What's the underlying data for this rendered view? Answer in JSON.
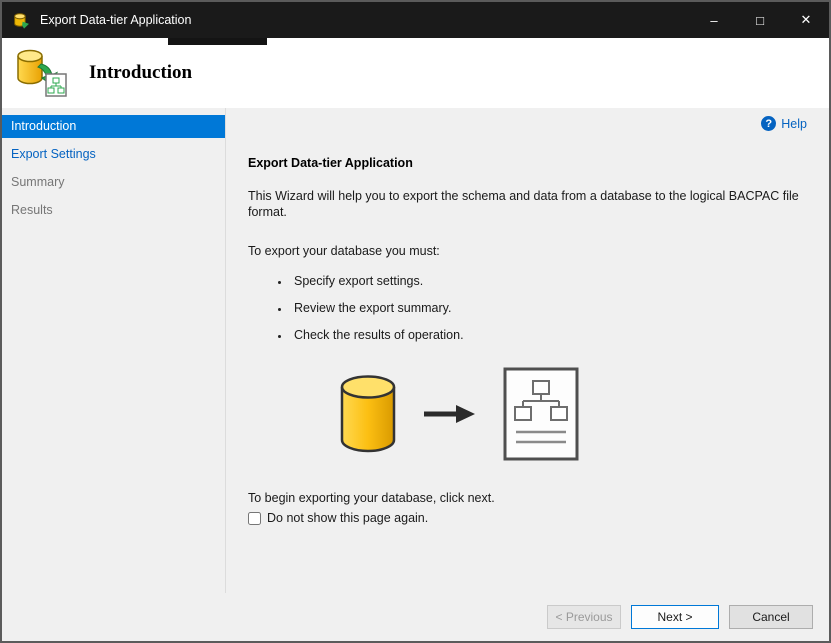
{
  "window": {
    "title": "Export Data-tier Application",
    "controls": {
      "minimize": "–",
      "maximize": "□",
      "close": "✕"
    }
  },
  "header": {
    "title": "Introduction"
  },
  "sidebar": {
    "items": [
      {
        "label": "Introduction",
        "state": "selected"
      },
      {
        "label": "Export Settings",
        "state": "link"
      },
      {
        "label": "Summary",
        "state": "disabled"
      },
      {
        "label": "Results",
        "state": "disabled"
      }
    ]
  },
  "content": {
    "help_label": "Help",
    "help_glyph": "?",
    "heading": "Export Data-tier Application",
    "intro": "This Wizard will help you to export the schema and data from a database to the logical BACPAC file format.",
    "requirements_lead": "To export your database you must:",
    "bullets": [
      "Specify export settings.",
      "Review the export summary.",
      "Check the results of operation."
    ],
    "illustration_icons": [
      "database-cylinder-icon",
      "right-arrow-icon",
      "bacpac-file-icon"
    ],
    "footer_note": "To begin exporting your database, click next.",
    "checkbox_label": "Do not show this page again.",
    "checkbox_checked": false
  },
  "buttons": {
    "previous": "< Previous",
    "next": "Next >",
    "cancel": "Cancel"
  },
  "colors": {
    "accent": "#0078d7",
    "link": "#0563c1",
    "titlebar": "#1a1a1a",
    "surface": "#f0f0f0",
    "header": "#ffffff",
    "cylinder_gold": "#fcbf12",
    "arrow_green": "#2ea84f"
  }
}
